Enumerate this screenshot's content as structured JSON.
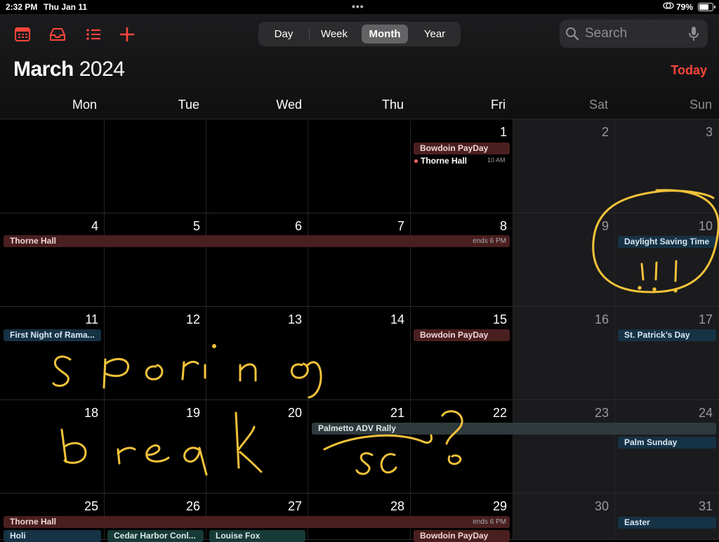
{
  "status": {
    "time": "2:32 PM",
    "date": "Thu Jan 11",
    "battery": "79%",
    "battery_level": 0.79
  },
  "toolbar": {
    "segments": [
      "Day",
      "Week",
      "Month",
      "Year"
    ],
    "active_segment": "Month",
    "search_placeholder": "Search",
    "today_label": "Today"
  },
  "title": {
    "month": "March",
    "year": "2024"
  },
  "weekdays": [
    "Mon",
    "Tue",
    "Wed",
    "Thu",
    "Fri",
    "Sat",
    "Sun"
  ],
  "days": [
    "1",
    "2",
    "3",
    "4",
    "5",
    "6",
    "7",
    "8",
    "9",
    "10",
    "11",
    "12",
    "13",
    "14",
    "15",
    "16",
    "17",
    "18",
    "19",
    "20",
    "21",
    "22",
    "23",
    "24",
    "25",
    "26",
    "27",
    "28",
    "29",
    "30",
    "31"
  ],
  "events": {
    "payday_1": "Bowdoin PayDay",
    "thorne_1": "Thorne Hall",
    "thorne_1_time": "10 AM",
    "thorne_week2": "Thorne Hall",
    "thorne_week2_end": "ends 6 PM",
    "dst": "Daylight Saving Time",
    "ramadan": "First Night of Rama...",
    "payday_15": "Bowdoin PayDay",
    "stpatrick": "St. Patrick’s Day",
    "palmetto": "Palmetto ADV Rally",
    "palm_sunday": "Palm Sunday",
    "thorne_week5": "Thorne Hall",
    "thorne_week5_end": "ends 6 PM",
    "easter": "Easter",
    "holi": "Holi",
    "cedar": "Cedar Harbor Conl...",
    "louise": "Louise Fox",
    "payday_29": "Bowdoin PayDay"
  },
  "colors": {
    "accent": "#ff453a",
    "ink": "#f2c23a"
  }
}
